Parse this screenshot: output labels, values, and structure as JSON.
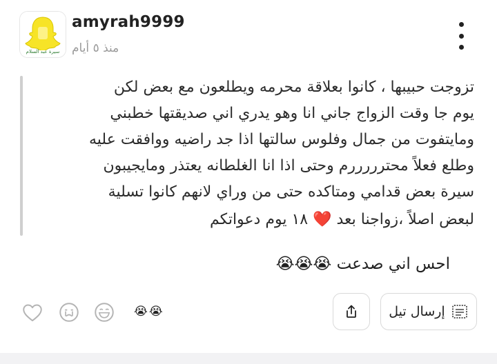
{
  "post": {
    "username": "amyrah9999",
    "timestamp": "منذ ٥ أيام",
    "avatar_caption": "سيرة عبد السلام",
    "quote_lines": [
      "تزوجت حبيبها ، كانوا بعلاقة محرمه ويطلعون مع بعض لكن",
      "يوم جا وقت الزواج جاني انا وهو يدري اني صديقتها خطبني",
      "ومايتفوت من جمال وفلوس سالتها اذا جد راضيه ووافقت عليه",
      "وطلع فعلاً محترررررم وحتى اذا انا الغلطانه يعتذر ومايجيبون",
      "سيرة بعض قدامي ومتاكده حتى من وراي لانهم كانوا تسلية",
      "١٨ يوم دعواتكم",
      "لبعض اصلاً ،زواجنا بعد"
    ],
    "quote_heart": "❤️",
    "body_text": "احس اني صدعت",
    "body_emojis": "😭😭😭"
  },
  "actions": {
    "reaction_summary": "😭😭",
    "send_label": "إرسال تيل",
    "icons": [
      "heart-outline-icon",
      "crying-face-icon",
      "laughing-face-icon",
      "share-icon",
      "send-card-icon",
      "more-vertical-icon"
    ]
  },
  "colors": {
    "heart": "#e3192b",
    "muted_text": "#9a9a9a",
    "border": "#d9d9d9",
    "avatar_yellow": "#f7e427"
  }
}
